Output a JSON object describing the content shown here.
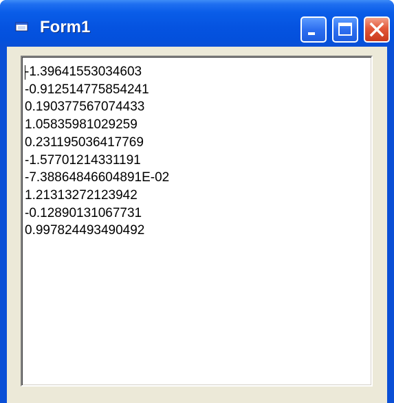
{
  "window": {
    "title": "Form1",
    "icon": "form-window-icon"
  },
  "title_buttons": {
    "minimize": "minimize-icon",
    "maximize": "maximize-icon",
    "close": "close-icon"
  },
  "textbox": {
    "lines": [
      "-1.39641553034603",
      "-0.912514775854241",
      "0.190377567074433",
      "1.05835981029259",
      "0.231195036417769",
      "-1.57701214331191",
      "-7.38864846604891E-02",
      "1.21313272123942",
      "-0.12890131067731",
      "0.997824493490492"
    ]
  },
  "colors": {
    "titlebar": "#0a4fd6",
    "client_background": "#ece9d8",
    "close_button": "#e2583a"
  }
}
